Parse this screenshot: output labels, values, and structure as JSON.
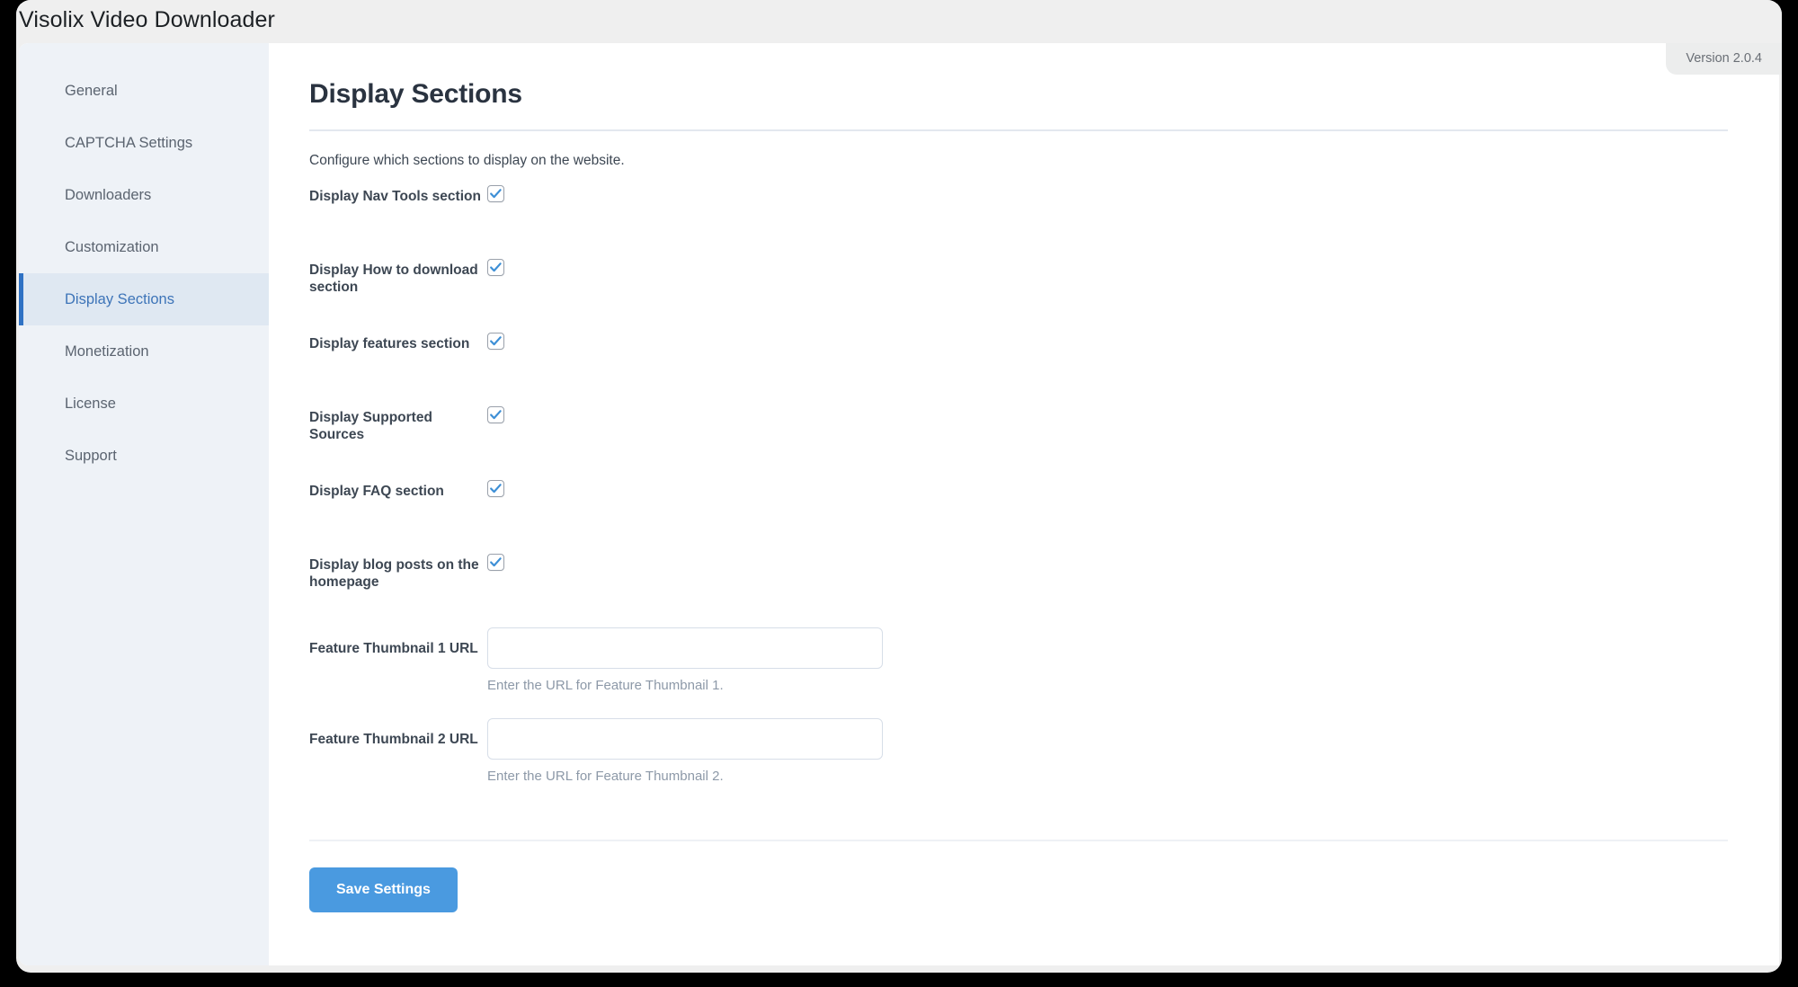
{
  "window": {
    "title": "Visolix Video Downloader"
  },
  "version_badge": {
    "label": "Version 2.0.4"
  },
  "sidebar": {
    "items": [
      {
        "label": "General",
        "active": false
      },
      {
        "label": "CAPTCHA Settings",
        "active": false
      },
      {
        "label": "Downloaders",
        "active": false
      },
      {
        "label": "Customization",
        "active": false
      },
      {
        "label": "Display Sections",
        "active": true
      },
      {
        "label": "Monetization",
        "active": false
      },
      {
        "label": "License",
        "active": false
      },
      {
        "label": "Support",
        "active": false
      }
    ]
  },
  "main": {
    "title": "Display Sections",
    "subtitle": "Configure which sections to display on the website.",
    "checkbox_rows": [
      {
        "label": "Display Nav Tools section",
        "checked": true
      },
      {
        "label": "Display How to download section",
        "checked": true
      },
      {
        "label": "Display features section",
        "checked": true
      },
      {
        "label": "Display Supported Sources",
        "checked": true
      },
      {
        "label": "Display FAQ section",
        "checked": true
      },
      {
        "label": "Display blog posts on the homepage",
        "checked": true
      }
    ],
    "text_rows": [
      {
        "label": "Feature Thumbnail 1 URL",
        "value": "",
        "placeholder": "",
        "help": "Enter the URL for Feature Thumbnail 1."
      },
      {
        "label": "Feature Thumbnail 2 URL",
        "value": "",
        "placeholder": "",
        "help": "Enter the URL for Feature Thumbnail 2."
      }
    ],
    "save_label": "Save Settings"
  },
  "colors": {
    "accent": "#4a9ae0",
    "active_nav": "#2f72c4",
    "sidebar_bg": "#eef2f7",
    "checkmark": "#3d8fd6"
  }
}
